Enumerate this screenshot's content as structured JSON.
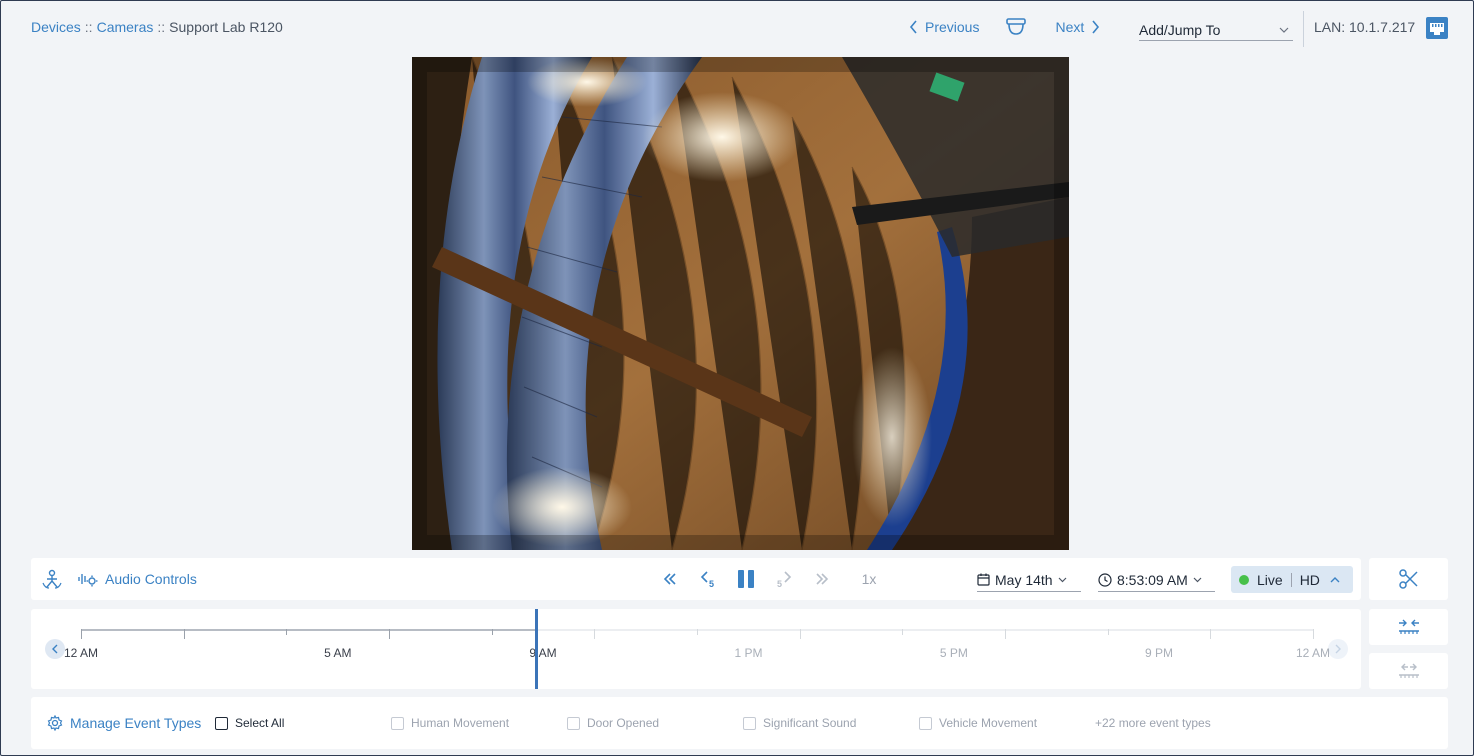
{
  "breadcrumb": {
    "devices": "Devices",
    "sep1": "::",
    "cameras": "Cameras",
    "sep2": "::",
    "current": "Support Lab R120"
  },
  "nav": {
    "previous": "Previous",
    "next": "Next",
    "add_jump": "Add/Jump To",
    "lan": "LAN: 10.1.7.217"
  },
  "controls": {
    "audio_label": "Audio Controls",
    "speed": "1x",
    "date": "May 14th",
    "time": "8:53:09 AM",
    "live": "Live",
    "quality": "HD"
  },
  "timeline": {
    "labels": [
      "12 AM",
      "5 AM",
      "9 AM",
      "1 PM",
      "5 PM",
      "9 PM",
      "12 AM"
    ],
    "position_fraction": 0.369
  },
  "events": {
    "manage": "Manage Event Types",
    "select_all": "Select All",
    "types": [
      "Human Movement",
      "Door Opened",
      "Significant Sound",
      "Vehicle Movement"
    ],
    "more": "+22 more event types"
  },
  "colors": {
    "accent": "#3b82c4",
    "live_dot": "#46c04a",
    "cursor": "#3b74b8"
  }
}
